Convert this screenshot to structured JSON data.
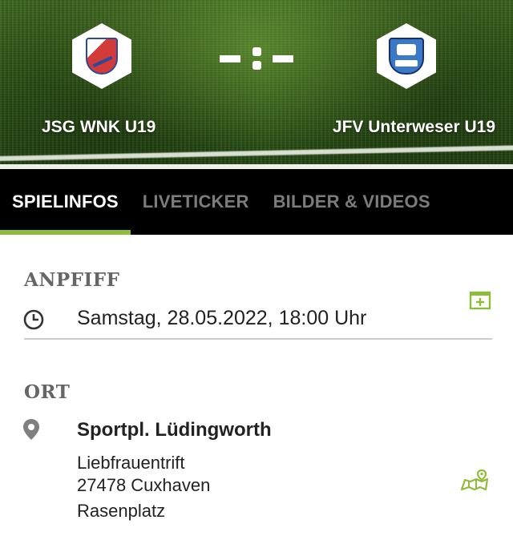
{
  "match": {
    "home_team": "JSG WNK U19",
    "away_team": "JFV Unterweser U19",
    "home_logo_icon": "club-crest-jsg-wnk",
    "away_logo_icon": "club-crest-jfv-unterweser",
    "score_placeholder": "-:-"
  },
  "tabs": [
    {
      "label": "SPIELINFOS",
      "active": true
    },
    {
      "label": "LIVETICKER",
      "active": false
    },
    {
      "label": "BILDER & VIDEOS",
      "active": false
    }
  ],
  "kickoff": {
    "title": "ANPFIFF",
    "datetime": "Samstag, 28.05.2022, 18:00 Uhr",
    "icon": "clock-icon",
    "action_icon": "calendar-add-icon"
  },
  "location": {
    "title": "ORT",
    "venue": "Sportpl. Lüdingworth",
    "street": "Liebfrauentrift",
    "city": "27478 Cuxhaven",
    "surface": "Rasenplatz",
    "icon": "location-pin-icon",
    "action_icon": "map-route-icon"
  },
  "colors": {
    "accent": "#8fbd3a",
    "tab_bar": "#000000",
    "tab_inactive": "#7c7c7c",
    "section_title": "#666666"
  }
}
